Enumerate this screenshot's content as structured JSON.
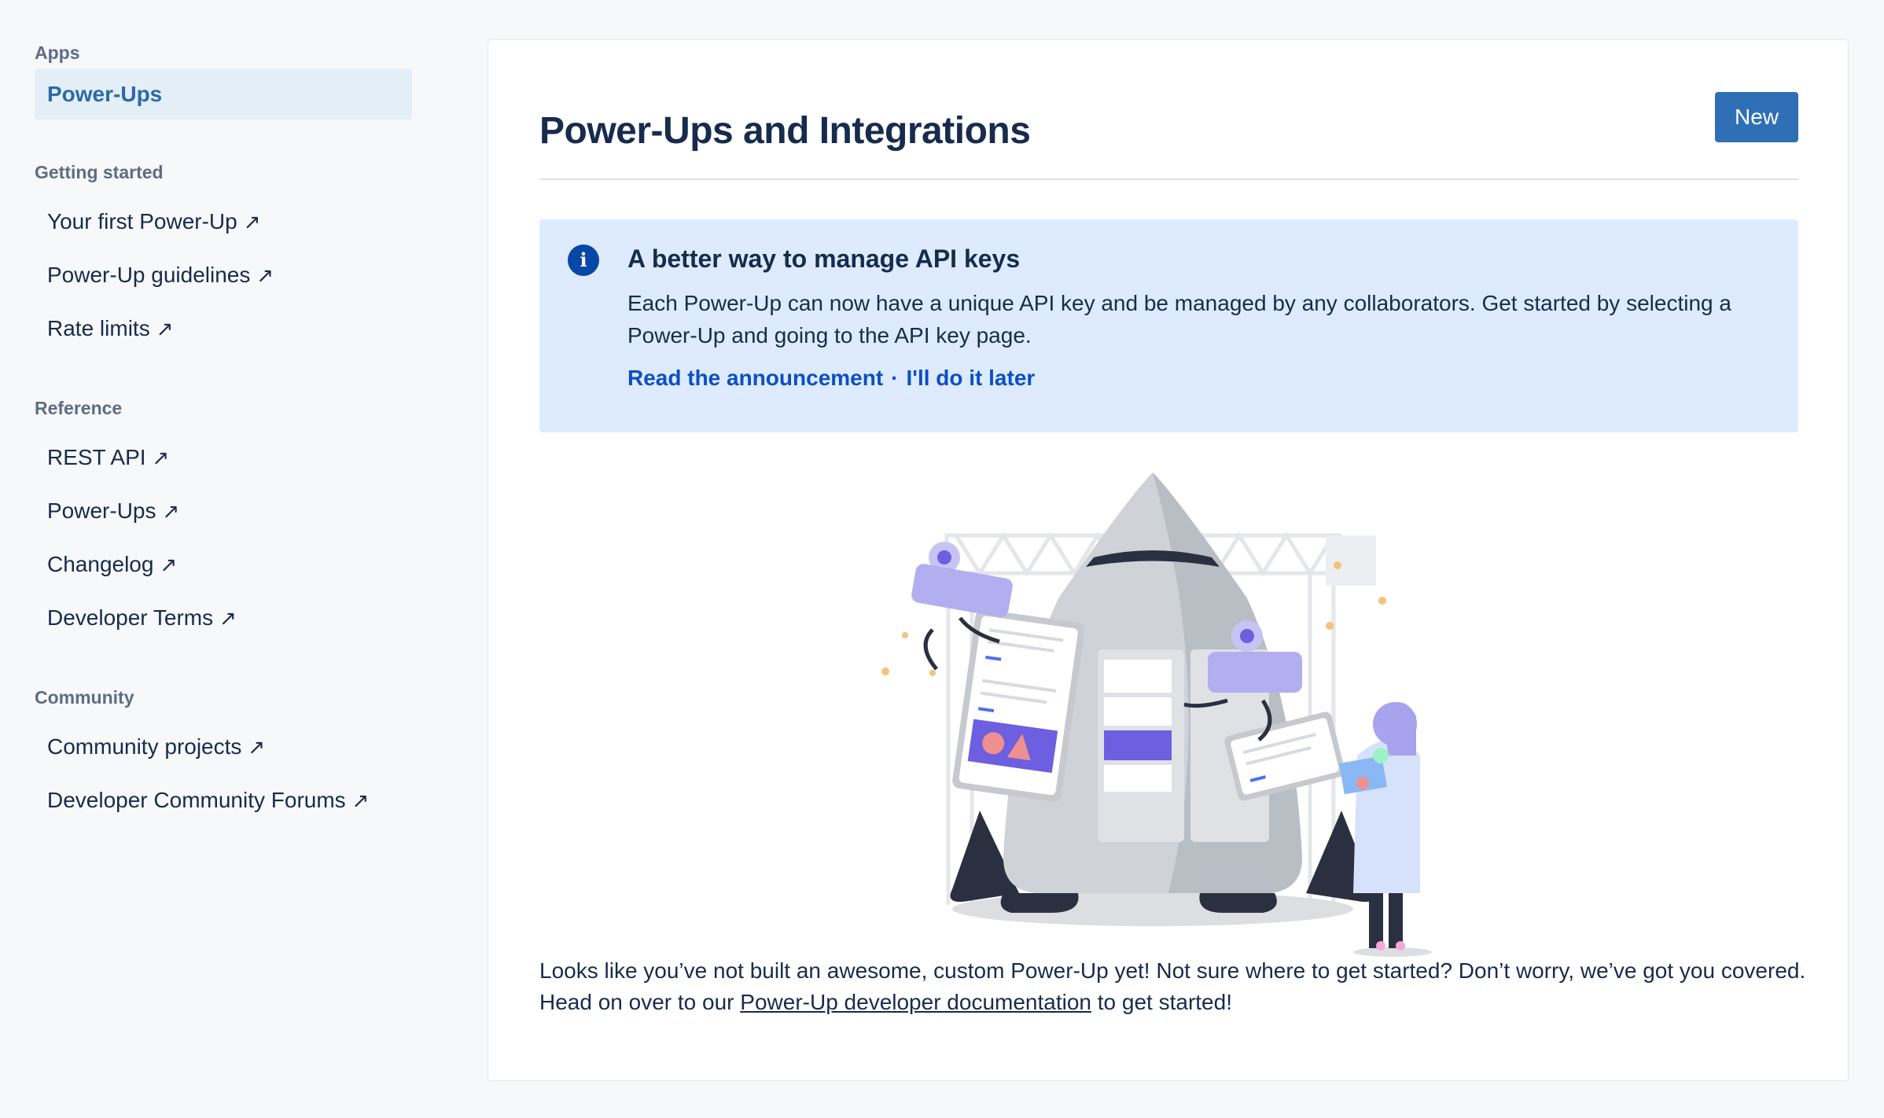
{
  "sidebar": {
    "apps_heading": "Apps",
    "active_item": "Power-Ups",
    "groups": [
      {
        "heading": "Getting started",
        "items": [
          "Your first Power-Up",
          "Power-Up guidelines",
          "Rate limits"
        ]
      },
      {
        "heading": "Reference",
        "items": [
          "REST API",
          "Power-Ups",
          "Changelog",
          "Developer Terms"
        ]
      },
      {
        "heading": "Community",
        "items": [
          "Community projects",
          "Developer Community Forums"
        ]
      }
    ],
    "external_arrow": "↗"
  },
  "main": {
    "title": "Power-Ups and Integrations",
    "new_button": "New",
    "banner": {
      "icon": "info-icon",
      "title": "A better way to manage API keys",
      "body": "Each Power-Up can now have a unique API key and be managed by any collaborators. Get started by selecting a Power-Up and going to the API key page.",
      "link_read": "Read the announcement",
      "separator": "·",
      "link_later": "I'll do it later"
    },
    "footer": {
      "text_before": "Looks like you’ve not built an awesome, custom Power-Up yet! Not sure where to get started? Don’t worry, we’ve got you covered. Head on over to our ",
      "link": "Power-Up developer documentation",
      "text_after": " to get started!"
    }
  },
  "colors": {
    "accent": "#2f6fb5",
    "banner_bg": "#deebff",
    "link": "#0c4fc4",
    "sidebar_active_bg": "#e4eef7"
  }
}
